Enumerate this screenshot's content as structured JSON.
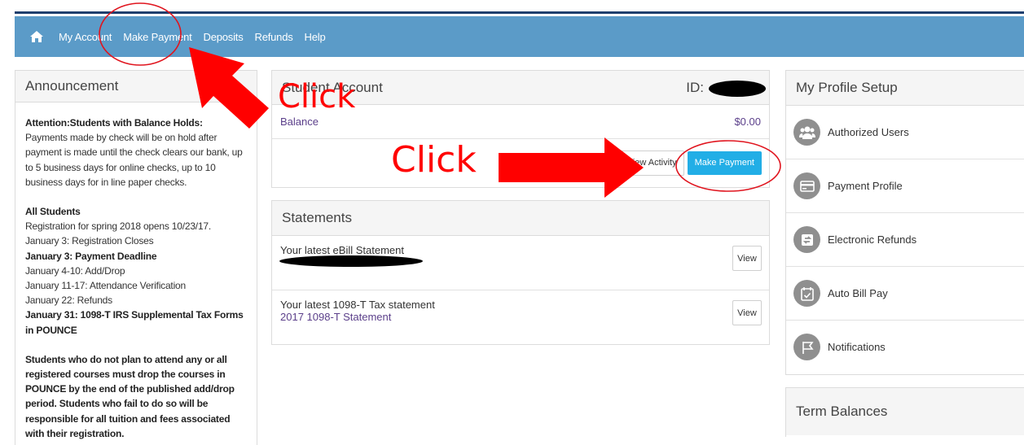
{
  "nav": {
    "items": [
      "My Account",
      "Make Payment",
      "Deposits",
      "Refunds",
      "Help"
    ]
  },
  "announcement": {
    "title": "Announcement",
    "hold_bold": "Attention:Students with Balance Holds:",
    "hold_text": " Payments made by check will be on hold after payment is made until the check clears our bank, up to 5 business days for online checks, up to 10 business days for in line paper checks.",
    "all_students": "All Students",
    "registration": "Registration for spring 2018 opens 10/23/17.",
    "reg_closes": "January 3: Registration Closes",
    "payment_deadline": "January 3: Payment Deadline",
    "add_drop": "January 4-10: Add/Drop",
    "attendance": "January 11-17: Attendance Verification",
    "refunds": "January 22: Refunds",
    "tax_forms": "January 31: 1098-T IRS Supplemental Tax Forms in POUNCE",
    "drop_notice": "Students who do not plan to attend any or all registered courses must drop the courses in POUNCE by the end of the published add/drop period. Students who fail to do so will be responsible for all tuition and fees associated with their registration."
  },
  "account": {
    "title": "Student Account",
    "id_label": "ID:",
    "balance_label": "Balance",
    "balance_value": "$0.00",
    "view_activity": "View Activity",
    "make_payment": "Make Payment"
  },
  "statements": {
    "title": "Statements",
    "rows": [
      {
        "text": "Your latest eBill Statement",
        "link": "",
        "button": "View"
      },
      {
        "text": "Your latest 1098-T Tax statement",
        "link": "2017 1098-T Statement",
        "button": "View"
      }
    ]
  },
  "profile": {
    "title": "My Profile Setup",
    "items": [
      {
        "label": "Authorized Users",
        "icon": "users-icon"
      },
      {
        "label": "Payment Profile",
        "icon": "card-icon"
      },
      {
        "label": "Electronic Refunds",
        "icon": "refund-icon"
      },
      {
        "label": "Auto Bill Pay",
        "icon": "calendar-icon"
      },
      {
        "label": "Notifications",
        "icon": "flag-icon"
      }
    ]
  },
  "terms": {
    "title": "Term Balances"
  },
  "annotations": {
    "click_1": "Click",
    "click_2": "Click",
    "color": "#ff0000"
  }
}
